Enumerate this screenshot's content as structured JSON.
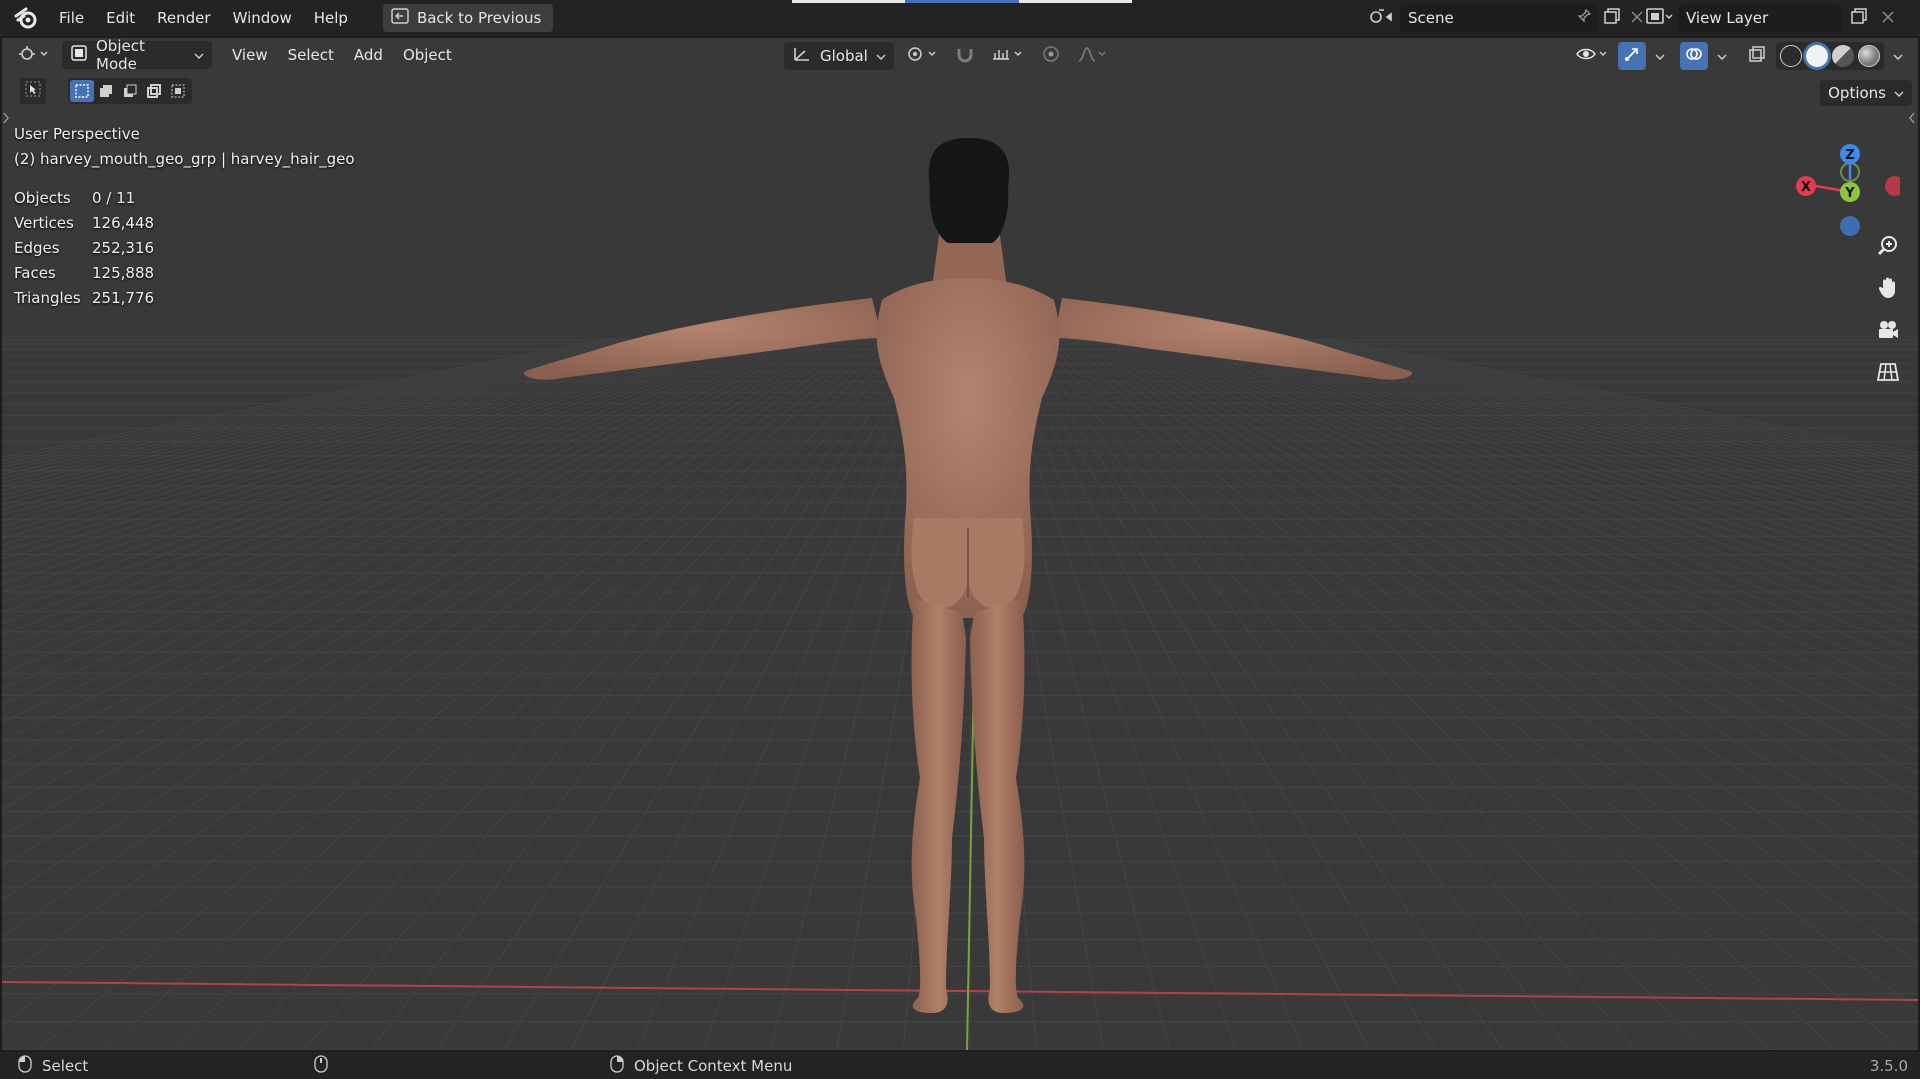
{
  "app": {
    "menus": [
      "File",
      "Edit",
      "Render",
      "Window",
      "Help"
    ],
    "back_button": "Back to Previous",
    "scene_name": "Scene",
    "view_layer": "View Layer",
    "version": "3.5.0"
  },
  "viewport_header": {
    "mode": "Object Mode",
    "menus": [
      "View",
      "Select",
      "Add",
      "Object"
    ],
    "transform_orientation": "Global",
    "options_label": "Options"
  },
  "overlay": {
    "perspective": "User Perspective",
    "active_object": "(2) harvey_mouth_geo_grp | harvey_hair_geo"
  },
  "stats": [
    {
      "label": "Objects",
      "value": "0 / 11"
    },
    {
      "label": "Vertices",
      "value": "126,448"
    },
    {
      "label": "Edges",
      "value": "252,316"
    },
    {
      "label": "Faces",
      "value": "125,888"
    },
    {
      "label": "Triangles",
      "value": "251,776"
    }
  ],
  "gizmo": {
    "x_label": "X",
    "y_label": "Y",
    "z_label": "Z"
  },
  "statusbar": {
    "left_action": "Select",
    "right_action": "Object Context Menu"
  },
  "colors": {
    "accent": "#4772b3",
    "axis_x": "#e23c54",
    "axis_y": "#8bc63e",
    "axis_z": "#3b8bea",
    "skin": "#a57561",
    "hair": "#141414"
  }
}
